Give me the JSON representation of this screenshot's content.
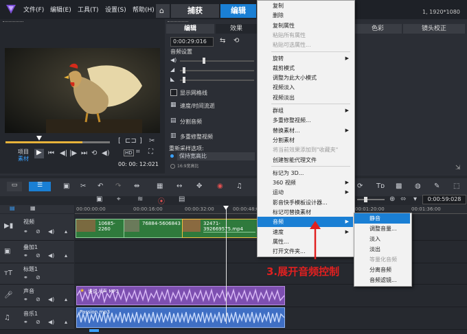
{
  "menubar": {
    "items": [
      "文件(F)",
      "编辑(E)",
      "工具(T)",
      "设置(S)",
      "帮助(H)"
    ]
  },
  "tabs": {
    "capture": "捕获",
    "edit": "编辑"
  },
  "resolution": "1, 1920*1080",
  "options": {
    "tab_edit": "编辑",
    "tab_effect": "效果",
    "timecode": "0:00:29:016",
    "audio_settings": "音频设置",
    "show_grid": "显示网格线",
    "speed_time": "速度/时间流逝",
    "split_audio": "分割音频",
    "multi_trim": "多重修整视频",
    "resample": "重新采样选项:",
    "keep_aspect": "保持宽高比",
    "small_text": "16:9宽高比"
  },
  "right_panel": {
    "tab_color": "色彩",
    "tab_lens": "镜头校正"
  },
  "preview": {
    "project_label": "项目",
    "clip_label": "素材",
    "ratio": "16:9",
    "timecode": "00: 00: 12:021",
    "quality": "HD"
  },
  "timeline": {
    "ruler": [
      "00:00:00:00",
      "00:00:16:00",
      "00:00:32:00",
      "00:00:48:00",
      "00:01:20:00",
      "00:01:36:00"
    ],
    "timecode": "0:00:59:028",
    "tracks": [
      {
        "name": "视频"
      },
      {
        "name": "叠加1"
      },
      {
        "name": "标题1"
      },
      {
        "name": "声音"
      },
      {
        "name": "音乐1"
      }
    ],
    "clips": {
      "v1": "10685-2260",
      "v2": "76884-5606843",
      "v3": "32471-392669575.mp4",
      "voice": "谁说人声 MP3",
      "music": "Passion.mp3"
    }
  },
  "context_menu": {
    "items": [
      {
        "label": "复制",
        "disabled": false,
        "sub": false
      },
      {
        "label": "删除",
        "disabled": false,
        "sub": false
      },
      {
        "label": "复制属性",
        "disabled": false,
        "sub": false
      },
      {
        "label": "粘贴所有属性",
        "disabled": true,
        "sub": false
      },
      {
        "label": "粘贴可选属性...",
        "disabled": true,
        "sub": false
      },
      {
        "label": "旋转",
        "disabled": false,
        "sub": true
      },
      {
        "label": "裁剪模式",
        "disabled": false,
        "sub": false
      },
      {
        "label": "调整为此大小模式",
        "disabled": false,
        "sub": false
      },
      {
        "label": "视频淡入",
        "disabled": false,
        "sub": false
      },
      {
        "label": "视频淡出",
        "disabled": false,
        "sub": false
      },
      {
        "label": "群组",
        "disabled": false,
        "sub": true
      },
      {
        "label": "多重修整视频...",
        "disabled": false,
        "sub": false
      },
      {
        "label": "替换素材...",
        "disabled": false,
        "sub": true
      },
      {
        "label": "分割素材",
        "disabled": false,
        "sub": false
      },
      {
        "label": "将当前效果添加到\"收藏夹\"",
        "disabled": true,
        "sub": false
      },
      {
        "label": "创建智能代理文件",
        "disabled": false,
        "sub": false
      },
      {
        "label": "标记为 3D...",
        "disabled": false,
        "sub": false
      },
      {
        "label": "360 视频",
        "disabled": false,
        "sub": true
      },
      {
        "label": "运动",
        "disabled": false,
        "sub": true
      },
      {
        "label": "影音快手模板设计器...",
        "disabled": false,
        "sub": false
      },
      {
        "label": "标记可替换素材",
        "disabled": false,
        "sub": false
      },
      {
        "label": "音频",
        "disabled": false,
        "sub": true,
        "selected": true
      },
      {
        "label": "速度",
        "disabled": false,
        "sub": true
      },
      {
        "label": "属性...",
        "disabled": false,
        "sub": false
      },
      {
        "label": "打开文件夹...",
        "disabled": false,
        "sub": false
      }
    ]
  },
  "submenu": {
    "items": [
      {
        "label": "静音",
        "disabled": false,
        "selected": true
      },
      {
        "label": "调整音量...",
        "disabled": false
      },
      {
        "label": "淡入",
        "disabled": false
      },
      {
        "label": "淡出",
        "disabled": false
      },
      {
        "label": "等量化音频",
        "disabled": true
      },
      {
        "label": "分离音频",
        "disabled": false
      },
      {
        "label": "音频滤镜...",
        "disabled": false
      }
    ]
  },
  "annotation": "3.展开音频控制",
  "colors": {
    "accent": "#1a7fd4",
    "annotation": "#e02020",
    "video_track": "#2f7a3c",
    "voice_track": "#7d4fb0",
    "music_track": "#3f6fc4"
  }
}
